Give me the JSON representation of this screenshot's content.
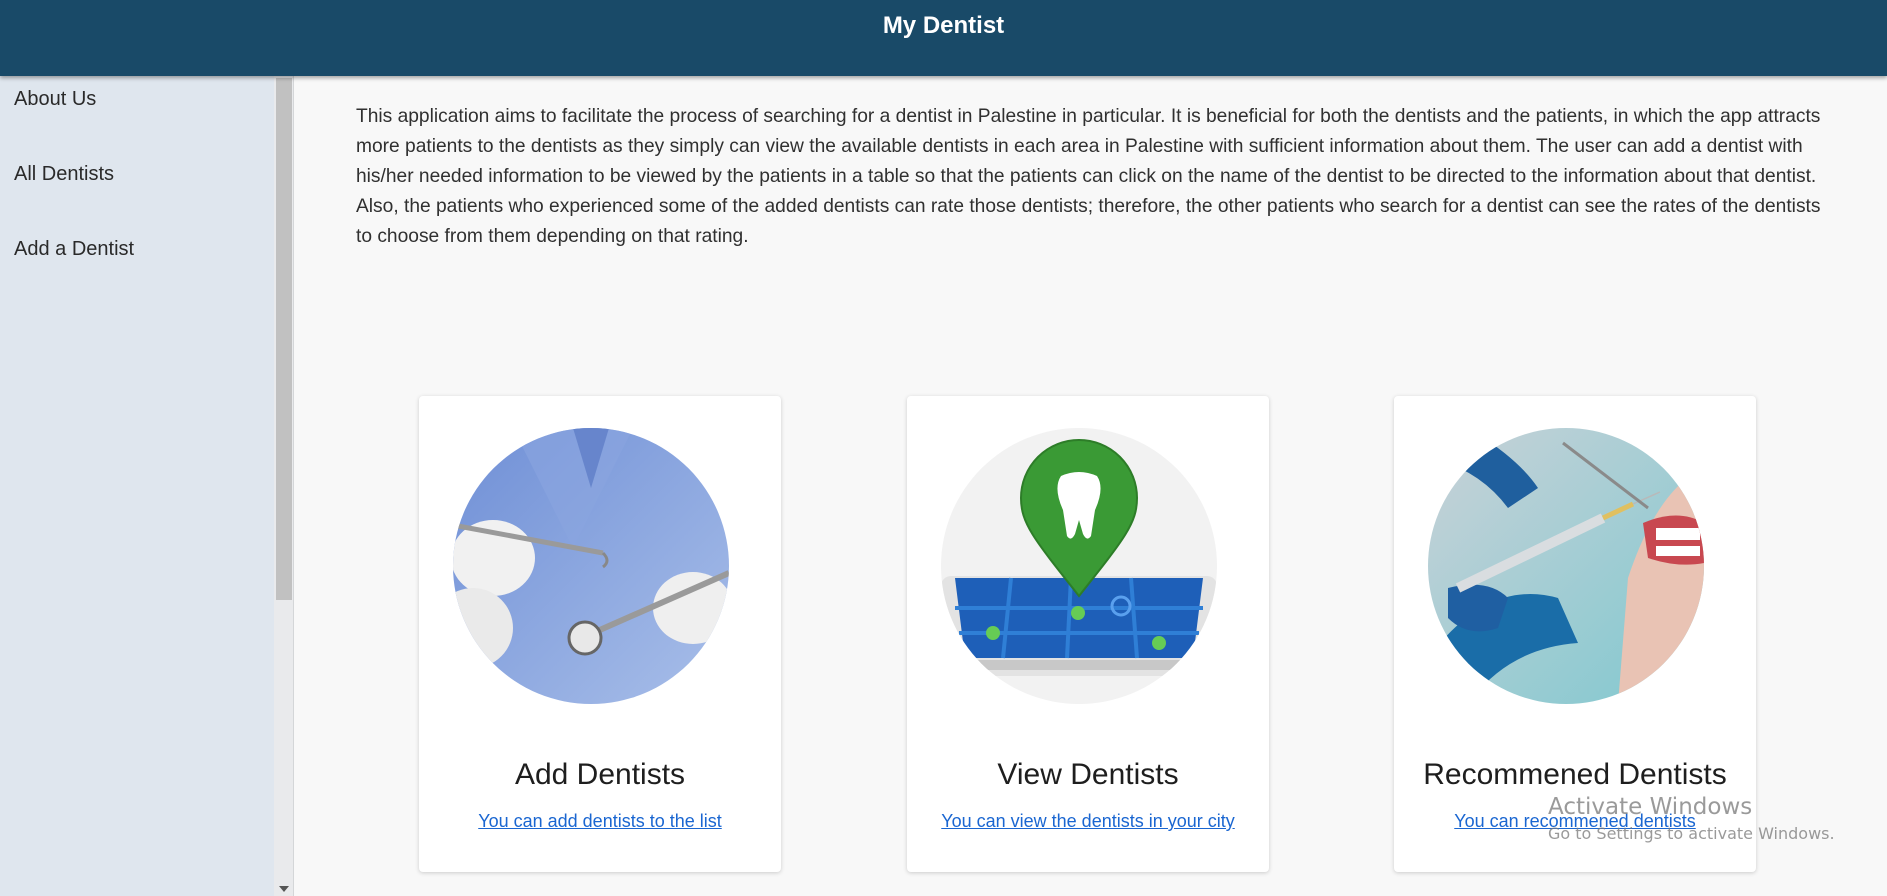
{
  "header": {
    "title": "My Dentist"
  },
  "sidebar": {
    "items": [
      {
        "label": "About Us"
      },
      {
        "label": "All Dentists"
      },
      {
        "label": "Add a Dentist"
      }
    ]
  },
  "main": {
    "intro": "This application aims to facilitate the process of searching for a dentist in Palestine in particular. It is beneficial for both the dentists and the patients, in which the app attracts more patients to the dentists as they simply can view the available dentists in each area in Palestine with sufficient information about them. The user can add a dentist with his/her needed information to be viewed by the patients in a table so that the patients can click on the name of the dentist to be directed to the information about that dentist. Also, the patients who experienced some of the added dentists can rate those dentists; therefore, the other patients who search for a dentist can see the rates of the dentists to choose from them depending on that rating.",
    "cards": [
      {
        "title": "Add Dentists",
        "link": "You can add dentists to the list",
        "image": "dental-tools-image"
      },
      {
        "title": "View Dentists",
        "link": "You can view the dentists in your city",
        "image": "tooth-map-pin-image"
      },
      {
        "title": "Recommened Dentists",
        "link": "You can recommened dentists",
        "image": "dental-procedure-image"
      }
    ]
  },
  "watermark": {
    "line1": "Activate Windows",
    "line2": "Go to Settings to activate Windows."
  },
  "colors": {
    "header_bg": "#194a68",
    "sidebar_bg": "#dfe6ee",
    "link": "#1a66d1",
    "pin_green": "#3a9a35"
  }
}
